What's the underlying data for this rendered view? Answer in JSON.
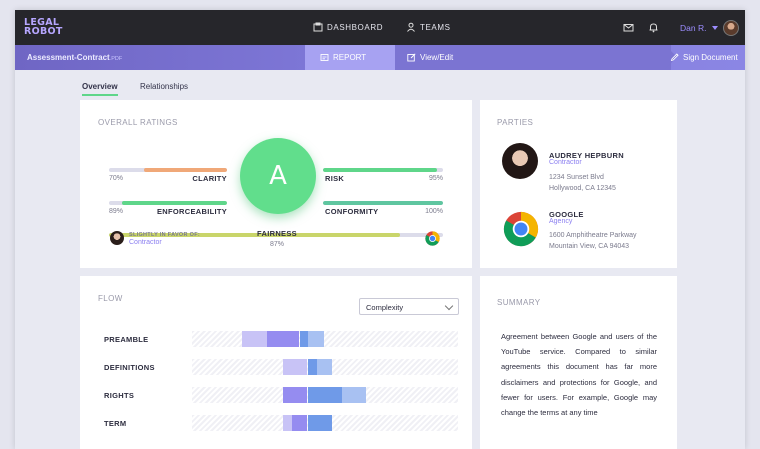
{
  "app": {
    "logo_line1": "LEGAL",
    "logo_line2": "ROBOT",
    "nav": {
      "dashboard": "DASHBOARD",
      "teams": "TEAMS"
    },
    "user": "Dan R."
  },
  "document": {
    "name": "Assessment-Contract",
    "ext": ".PDF",
    "tabs": {
      "report": "REPORT",
      "view_edit": "View/Edit",
      "sign": "Sign Document"
    }
  },
  "page_tabs": {
    "overview": "Overview",
    "relationships": "Relationships"
  },
  "ratings": {
    "title": "OVERALL RATINGS",
    "grade": "A",
    "clarity": {
      "label": "CLARITY",
      "pct": "70%",
      "value": 0.7,
      "color": "#f0a878"
    },
    "risk": {
      "label": "RISK",
      "pct": "95%",
      "value": 0.95,
      "color": "#5fd68a"
    },
    "enforceability": {
      "label": "ENFORCEABILITY",
      "pct": "89%",
      "value": 0.89,
      "color": "#5fd68a"
    },
    "conformity": {
      "label": "CONFORMITY",
      "pct": "100%",
      "value": 1.0,
      "color": "#5fc6a0"
    },
    "fairness": {
      "label": "FAIRNESS",
      "pct": "87%",
      "value": 0.87,
      "color": "#c9d56a"
    },
    "favor": {
      "text": "SLIGHTLY IN FAVOR OF:",
      "party": "Contractor"
    }
  },
  "parties": {
    "title": "PARTIES",
    "items": [
      {
        "name": "AUDREY HEPBURN",
        "role": "Contractor",
        "addr1": "1234 Sunset Blvd",
        "addr2": "Hollywood, CA 12345"
      },
      {
        "name": "GOOGLE",
        "role": "Agency",
        "addr1": "1600 Amphitheatre Parkway",
        "addr2": "Mountain View, CA 94043"
      }
    ]
  },
  "flow": {
    "title": "FLOW",
    "dropdown": "Complexity",
    "rows": [
      {
        "label": "PREAMBLE",
        "cells": [
          0,
          0,
          0,
          0,
          0,
          0,
          2,
          2,
          2,
          3,
          3,
          3,
          0,
          4,
          5,
          0,
          0,
          0,
          0,
          0,
          0,
          0,
          0,
          0,
          0,
          0,
          0,
          0,
          0,
          0,
          0,
          0
        ]
      },
      {
        "label": "DEFINITIONS",
        "cells": [
          0,
          0,
          0,
          0,
          0,
          0,
          0,
          0,
          0,
          0,
          0,
          2,
          2,
          0,
          4,
          5,
          0,
          0,
          0,
          0,
          0,
          0,
          0,
          0,
          0,
          0,
          0,
          0,
          0,
          0,
          0,
          0
        ]
      },
      {
        "label": "RIGHTS",
        "cells": [
          0,
          0,
          0,
          0,
          0,
          0,
          0,
          0,
          0,
          0,
          0,
          3,
          3,
          0,
          4,
          4,
          4,
          4,
          5,
          5,
          0,
          0,
          0,
          0,
          0,
          0,
          0,
          0,
          0,
          0,
          0,
          0
        ]
      },
      {
        "label": "TERM",
        "cells": [
          0,
          0,
          0,
          0,
          0,
          0,
          0,
          0,
          0,
          0,
          0,
          2,
          3,
          0,
          4,
          4,
          0,
          0,
          0,
          0,
          0,
          0,
          0,
          0,
          0,
          0,
          0,
          0,
          0,
          0,
          0,
          0
        ]
      }
    ],
    "colors": {
      "2": "#c8c3f6",
      "3": "#958cf0",
      "4": "#6f9ae8",
      "5": "#a8c1f2"
    }
  },
  "summary": {
    "title": "SUMMARY",
    "text": "Agreement between Google and users of the YouTube service. Compared to similar agreements this document has far more disclaimers and protections for Google, and fewer for users. For example, Google may change the terms at any time"
  }
}
